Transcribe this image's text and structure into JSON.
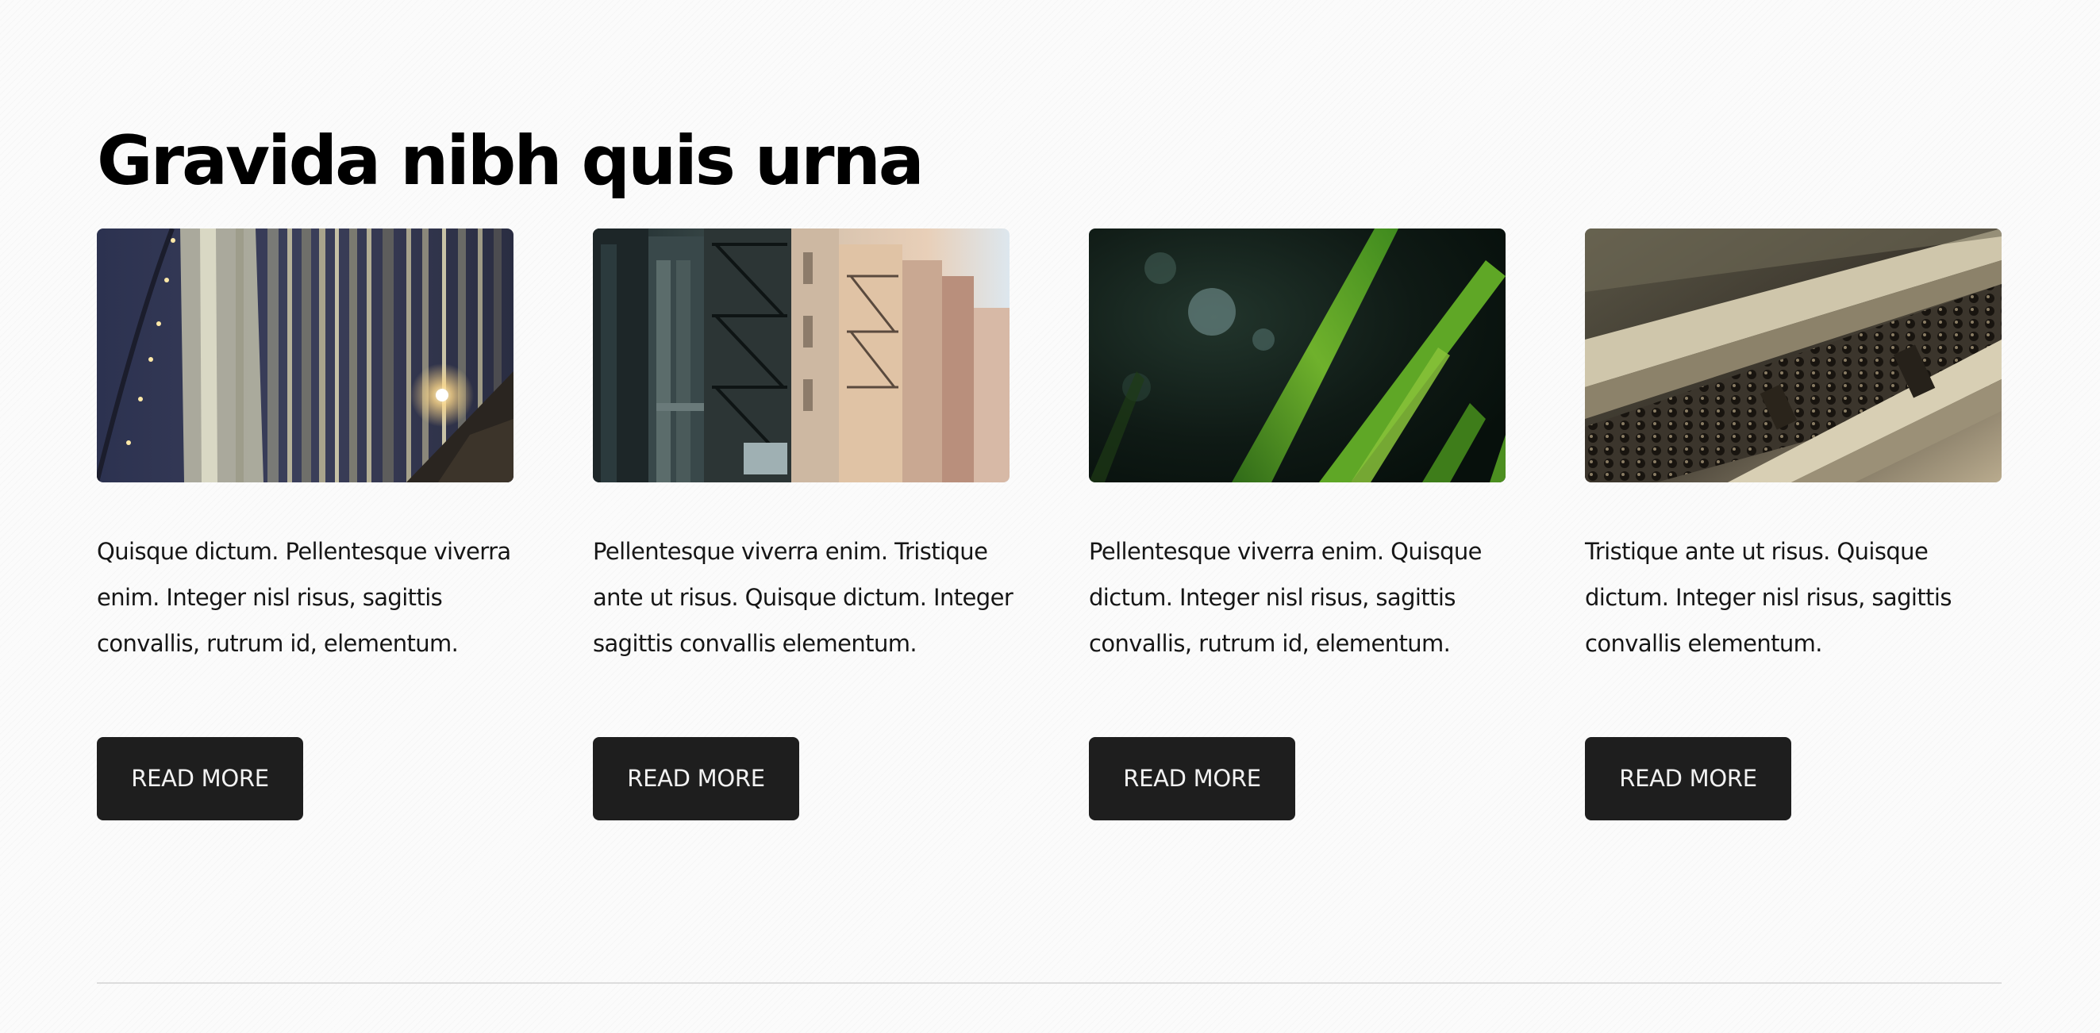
{
  "section": {
    "heading": "Gravida nibh quis urna",
    "cards": [
      {
        "image": "bridge-cables-photo",
        "text": "Quisque dictum. Pellentesque viverra enim. Integer nisl risus, sagittis convallis, rutrum id, elementum.",
        "button_label": "READ MORE"
      },
      {
        "image": "city-fire-escapes-photo",
        "text": "Pellentesque viverra enim. Tristique ante ut risus. Quisque dictum. Integer sagittis convallis elementum.",
        "button_label": "READ MORE"
      },
      {
        "image": "green-grass-blades-photo",
        "text": "Pellentesque viverra enim. Quisque dictum. Integer nisl risus, sagittis convallis, rutrum id, elementum.",
        "button_label": "READ MORE"
      },
      {
        "image": "railway-track-photo",
        "text": "Tristique ante ut risus. Quisque dictum. Integer nisl risus, sagittis convallis elementum.",
        "button_label": "READ MORE"
      }
    ]
  },
  "colors": {
    "button_bg": "#1e1e1e",
    "button_text": "#f2f2f2",
    "heading": "#000000",
    "divider": "#dcdcdc"
  }
}
